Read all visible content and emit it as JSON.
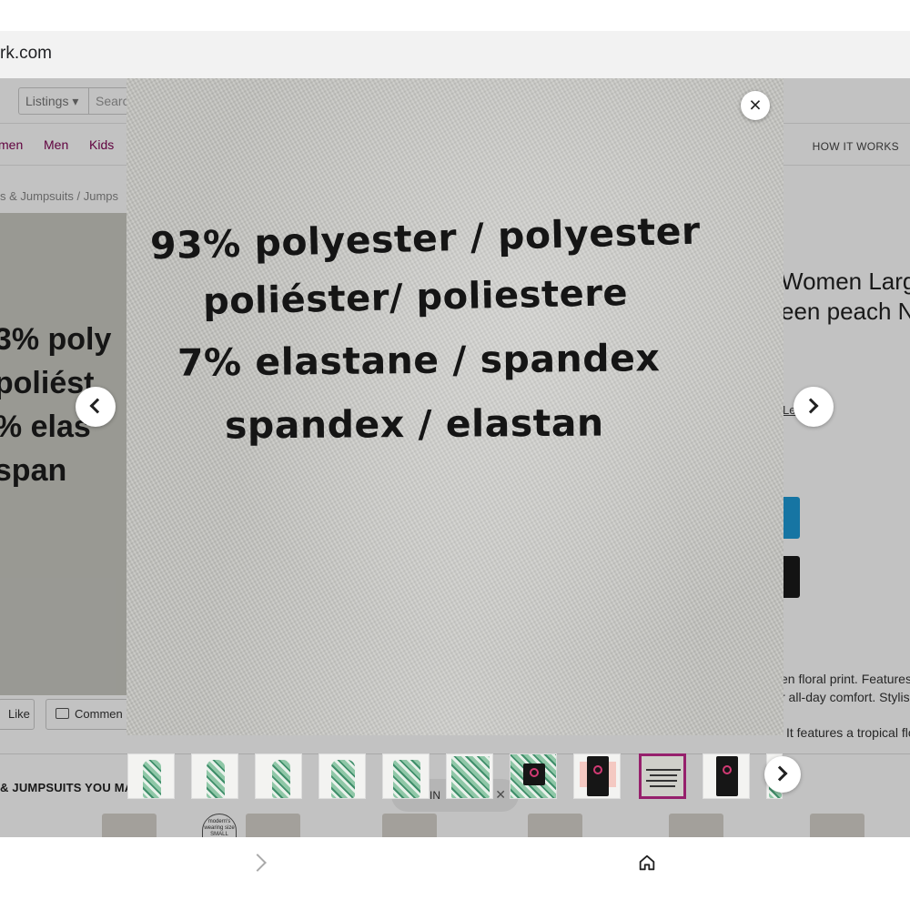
{
  "browser": {
    "url_fragment": "rk.com"
  },
  "page": {
    "listings_select": "Listings",
    "search_placeholder": "Searc",
    "nav": [
      "men",
      "Men",
      "Kids"
    ],
    "nav_right": "HOW IT WORKS",
    "breadcrumb": "s & Jumpsuits  /  Jumps",
    "left_photo_text": "93% poly\n  poliést\n7% elas\n  span",
    "like_label": "Like",
    "comment_label": "Commen",
    "product_title": "Women Larg\neen peach N",
    "learn_link": "Le         re .",
    "desc_lines": [
      "en floral print. Features",
      "r all-day comfort. Stylis",
      "It features a tropical flo"
    ],
    "section_title": "& JUMPSUITS YOU MAY",
    "popup_text": "N IN",
    "popup_close": "✕",
    "size_badge": "modern's\nwearing size\nSMALL"
  },
  "lightbox": {
    "label_lines": [
      "93% polyester / polyester",
      "poliéster/ poliestere",
      "7% elastane / spandex",
      "spandex / elastan"
    ],
    "close_glyph": "×",
    "thumbnail_count": 11,
    "selected_thumbnail": 9
  },
  "colors": {
    "brand": "#7f0353",
    "thumb_selected": "#96206c",
    "primary_button": "#1d9ad6"
  },
  "icons": [
    "close-icon",
    "chevron-left-icon",
    "chevron-right-icon",
    "comment-icon",
    "back-icon",
    "home-icon"
  ]
}
